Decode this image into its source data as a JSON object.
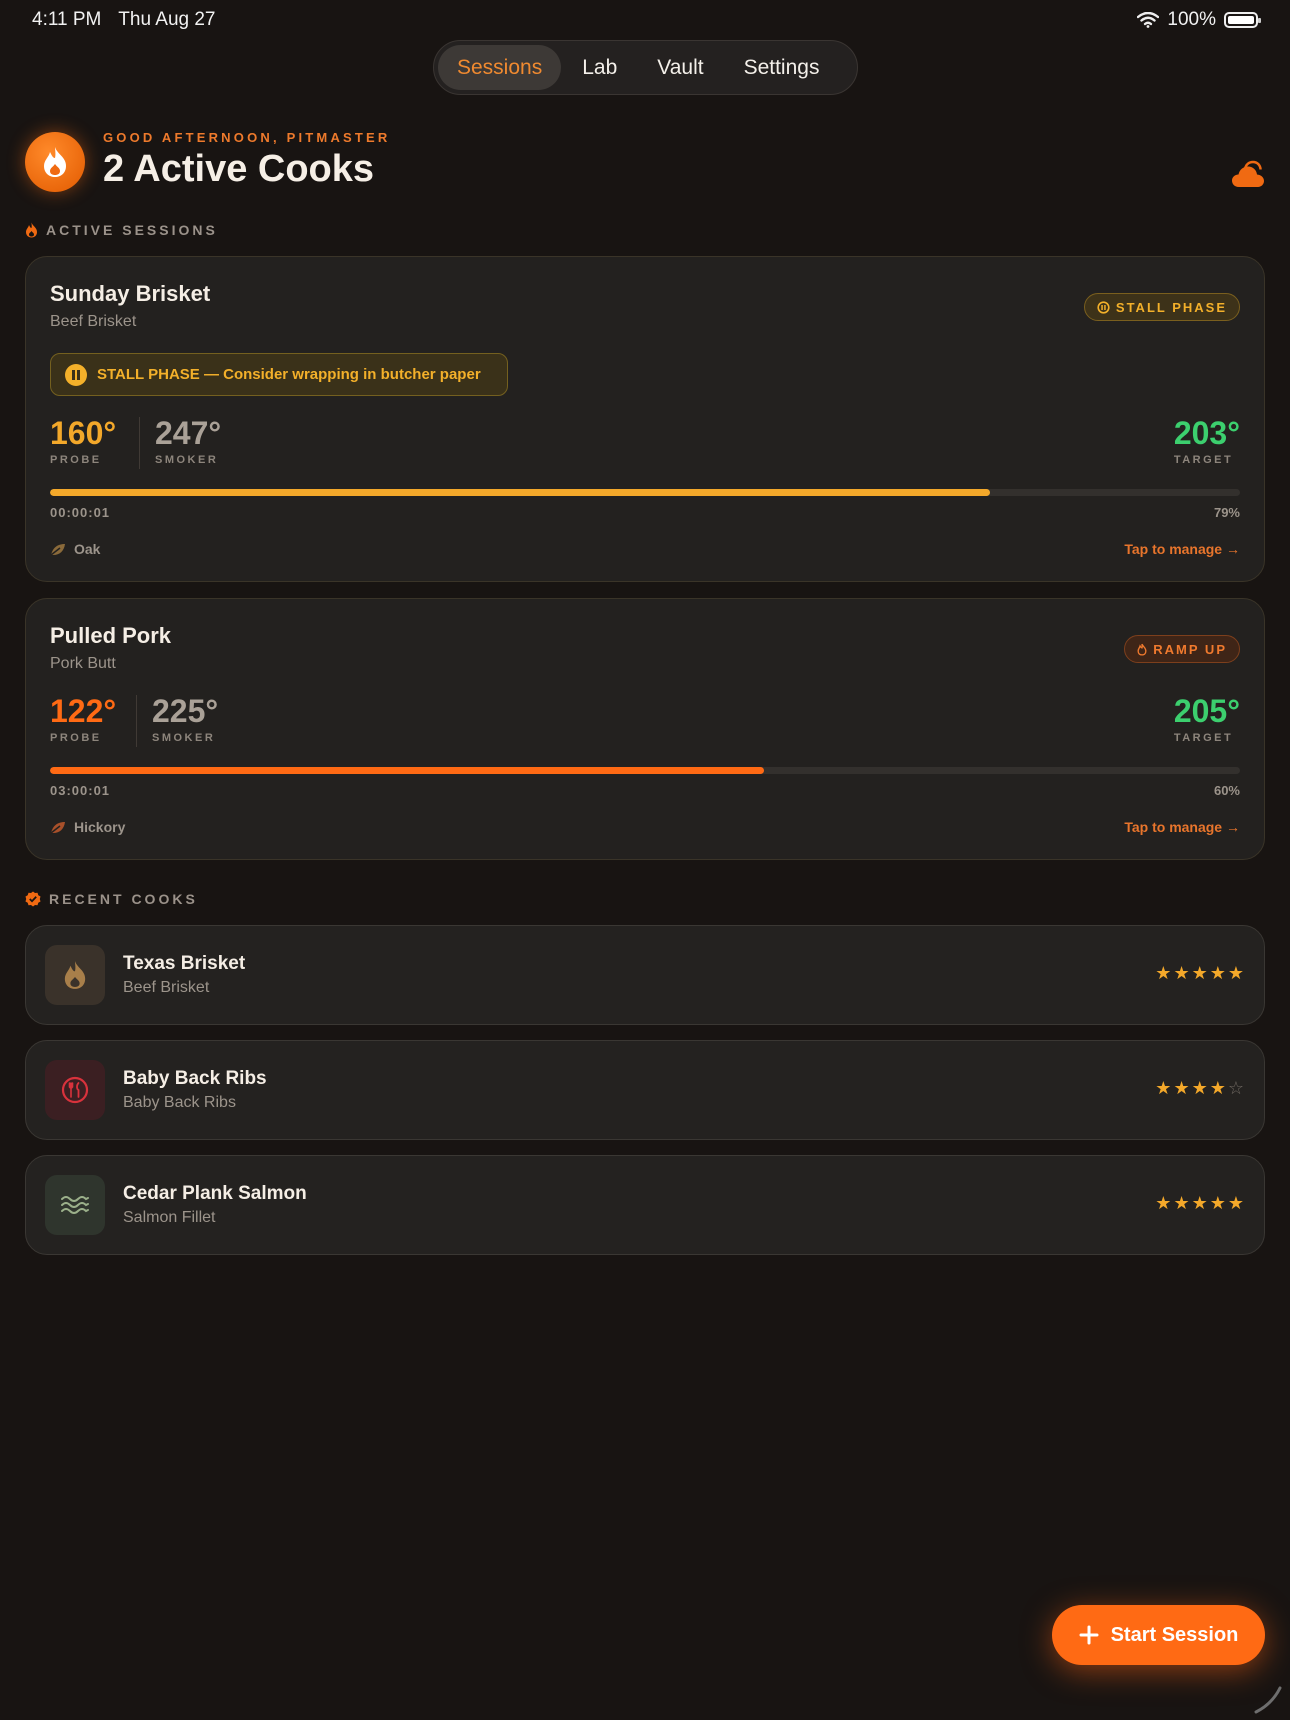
{
  "status_bar": {
    "time": "4:11 PM",
    "date": "Thu Aug 27",
    "battery": "100%"
  },
  "tabs": [
    {
      "label": "Sessions",
      "active": true
    },
    {
      "label": "Lab",
      "active": false
    },
    {
      "label": "Vault",
      "active": false
    },
    {
      "label": "Settings",
      "active": false
    }
  ],
  "header": {
    "greeting": "GOOD AFTERNOON, PITMASTER",
    "title": "2 Active Cooks"
  },
  "sections": {
    "active": "ACTIVE SESSIONS",
    "recent": "RECENT COOKS"
  },
  "active_sessions": [
    {
      "name": "Sunday Brisket",
      "cut": "Beef Brisket",
      "phase": "STALL PHASE",
      "phase_color": "#f3b02a",
      "alert": "STALL PHASE — Consider wrapping in butcher paper",
      "probe": "160°",
      "probe_label": "PROBE",
      "smoker": "247°",
      "smoker_label": "SMOKER",
      "target": "203°",
      "target_label": "TARGET",
      "progress_percent": 79,
      "progress_label": "79%",
      "elapsed": "00:00:01",
      "wood": "Oak",
      "manage": "Tap to manage →"
    },
    {
      "name": "Pulled Pork",
      "cut": "Pork Butt",
      "phase": "RAMP UP",
      "phase_color": "#f07a2e",
      "probe": "122°",
      "probe_label": "PROBE",
      "smoker": "225°",
      "smoker_label": "SMOKER",
      "target": "205°",
      "target_label": "TARGET",
      "progress_percent": 60,
      "progress_label": "60%",
      "elapsed": "03:00:01",
      "wood": "Hickory",
      "manage": "Tap to manage →"
    }
  ],
  "recent_cooks": [
    {
      "name": "Texas Brisket",
      "cut": "Beef Brisket",
      "icon": "flame-icon",
      "rating": 5
    },
    {
      "name": "Baby Back Ribs",
      "cut": "Baby Back Ribs",
      "icon": "fork-knife-icon",
      "rating": 4
    },
    {
      "name": "Cedar Plank Salmon",
      "cut": "Salmon Fillet",
      "icon": "waves-icon",
      "rating": 5
    }
  ],
  "colors": {
    "accent": "#ff6a14",
    "stall": "#f3b02a",
    "target": "#3ccf6e",
    "background": "#181412"
  },
  "fab": {
    "label": "Start Session"
  }
}
